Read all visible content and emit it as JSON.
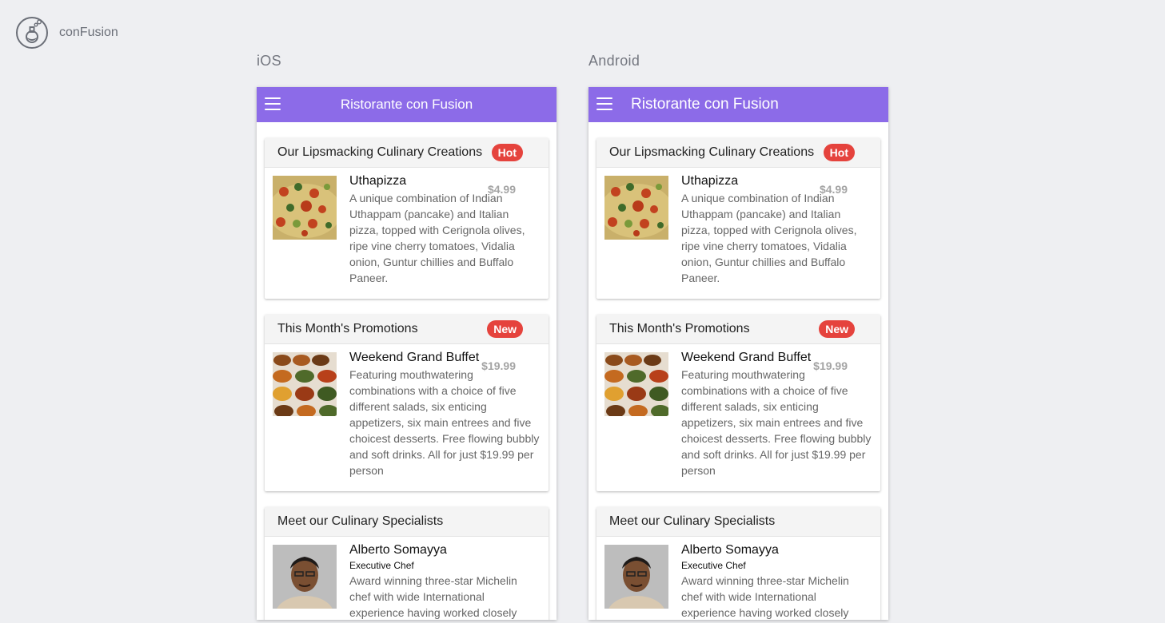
{
  "app": {
    "brand_name": "conFusion"
  },
  "panels": {
    "ios": {
      "label": "iOS"
    },
    "android": {
      "label": "Android"
    }
  },
  "toolbar": {
    "title": "Ristorante con Fusion"
  },
  "cards": {
    "dish": {
      "header": "Our Lipsmacking Culinary Creations",
      "badge": "Hot",
      "name": "Uthapizza",
      "price": "$4.99",
      "description": "A unique combination of Indian Uthappam (pancake) and Italian pizza, topped with Cerignola olives, ripe vine cherry tomatoes, Vidalia onion, Guntur chillies and Buffalo Paneer."
    },
    "promotion": {
      "header": "This Month's Promotions",
      "badge": "New",
      "name": "Weekend Grand Buffet",
      "price": "$19.99",
      "description": "Featuring mouthwatering combinations with a choice of five different salads, six enticing appetizers, six main entrees and five choicest desserts. Free flowing bubbly and soft drinks. All for just $19.99 per person"
    },
    "leader": {
      "header": "Meet our Culinary Specialists",
      "name": "Alberto Somayya",
      "designation": "Executive Chef",
      "description": "Award winning three-star Michelin chef with wide International experience having worked closely"
    }
  },
  "colors": {
    "toolbar": "#8c6be8",
    "badge": "#e5433d",
    "background": "#eeeff2"
  },
  "icons": {
    "brand": "flask-logo-icon",
    "menu": "hamburger-menu-icon"
  }
}
